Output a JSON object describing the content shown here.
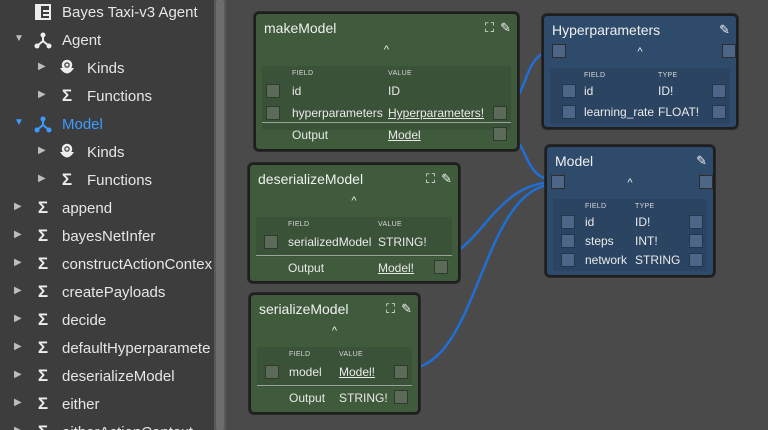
{
  "sidebar": {
    "items": [
      {
        "label": "Bayes Taxi-v3 Agent",
        "icon": "app-icon",
        "arrow": "",
        "active": false
      },
      {
        "label": "Agent",
        "icon": "graph-icon",
        "arrow": "down",
        "active": false
      },
      {
        "label": "Kinds",
        "icon": "kinds-icon",
        "arrow": "right",
        "active": false
      },
      {
        "label": "Functions",
        "icon": "sigma-icon",
        "arrow": "right",
        "active": false
      },
      {
        "label": "Model",
        "icon": "graph-icon",
        "arrow": "down",
        "active": true
      },
      {
        "label": "Kinds",
        "icon": "kinds-icon",
        "arrow": "right",
        "active": false
      },
      {
        "label": "Functions",
        "icon": "sigma-icon",
        "arrow": "right",
        "active": false
      },
      {
        "label": "append",
        "icon": "sigma-icon",
        "arrow": "right",
        "active": false
      },
      {
        "label": "bayesNetInfer",
        "icon": "sigma-icon",
        "arrow": "right",
        "active": false
      },
      {
        "label": "constructActionContex",
        "icon": "sigma-icon",
        "arrow": "right",
        "active": false
      },
      {
        "label": "createPayloads",
        "icon": "sigma-icon",
        "arrow": "right",
        "active": false
      },
      {
        "label": "decide",
        "icon": "sigma-icon",
        "arrow": "right",
        "active": false
      },
      {
        "label": "defaultHyperparamete",
        "icon": "sigma-icon",
        "arrow": "right",
        "active": false
      },
      {
        "label": "deserializeModel",
        "icon": "sigma-icon",
        "arrow": "right",
        "active": false
      },
      {
        "label": "either",
        "icon": "sigma-icon",
        "arrow": "right",
        "active": false
      },
      {
        "label": "eitherActionContext",
        "icon": "sigma-icon",
        "arrow": "right",
        "active": false
      }
    ]
  },
  "nodes": {
    "makeModel": {
      "title": "makeModel",
      "header_field": "FIELD",
      "header_value": "VALUE",
      "rows": [
        {
          "field": "id",
          "value": "ID",
          "link": false
        },
        {
          "field": "hyperparameters",
          "value": "Hyperparameters!",
          "link": true
        }
      ],
      "output_label": "Output",
      "output_value": "Model",
      "output_link": true
    },
    "hyperparameters": {
      "title": "Hyperparameters",
      "header_field": "FIELD",
      "header_value": "TYPE",
      "rows": [
        {
          "field": "id",
          "value": "ID!"
        },
        {
          "field": "learning_rate",
          "value": "FLOAT!"
        }
      ]
    },
    "model": {
      "title": "Model",
      "header_field": "FIELD",
      "header_value": "TYPE",
      "rows": [
        {
          "field": "id",
          "value": "ID!"
        },
        {
          "field": "steps",
          "value": "INT!"
        },
        {
          "field": "network",
          "value": "STRING"
        }
      ]
    },
    "deserializeModel": {
      "title": "deserializeModel",
      "header_field": "FIELD",
      "header_value": "VALUE",
      "rows": [
        {
          "field": "serializedModel",
          "value": "STRING!",
          "link": false
        }
      ],
      "output_label": "Output",
      "output_value": "Model!",
      "output_link": true
    },
    "serializeModel": {
      "title": "serializeModel",
      "header_field": "FIELD",
      "header_value": "VALUE",
      "rows": [
        {
          "field": "model",
          "value": "Model!",
          "link": true
        }
      ],
      "output_label": "Output",
      "output_value": "STRING!",
      "output_link": false
    }
  },
  "colors": {
    "accent": "#3d9bff",
    "link_line": "#1f6fd6",
    "green_node": "#3f5b3c",
    "blue_node": "#2f4b6b"
  }
}
